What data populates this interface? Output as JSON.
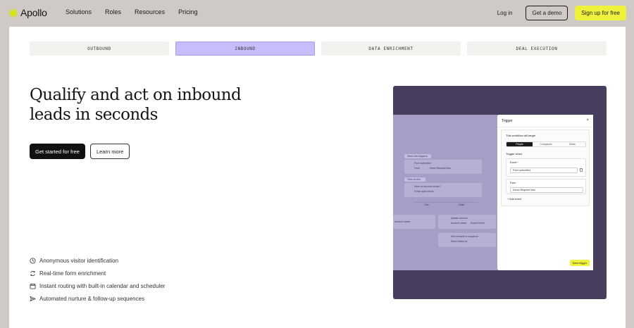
{
  "nav": {
    "brand": "Apollo",
    "links": [
      "Solutions",
      "Roles",
      "Resources",
      "Pricing"
    ],
    "login": "Log in",
    "demo": "Get a demo",
    "signup": "Sign up for free",
    "signup_color": "#eef23a"
  },
  "tabs": [
    {
      "label": "OUTBOUND",
      "active": false
    },
    {
      "label": "INBOUND",
      "active": true
    },
    {
      "label": "DATA ENRICHMENT",
      "active": false
    },
    {
      "label": "DEAL EXECUTION",
      "active": false
    }
  ],
  "hero": {
    "headline_line1": "Qualify and act on inbound",
    "headline_line2": "leads in seconds",
    "primary_cta": "Get started for free",
    "secondary_cta": "Learn more"
  },
  "features": [
    {
      "icon": "visitor-id-icon",
      "text": "Anonymous visitor identification"
    },
    {
      "icon": "refresh-icon",
      "text": "Real-time form enrichment"
    },
    {
      "icon": "calendar-icon",
      "text": "Instant routing with built-in calendar and scheduler"
    },
    {
      "icon": "send-icon",
      "text": "Automated nurture & follow-up sequences"
    }
  ],
  "product": {
    "canvas": {
      "when_label": "When this happens",
      "form_title": "Form submitted",
      "form_sub": "Form",
      "form_chip": "Demo Request Inbo",
      "then_label": "Then do this",
      "owner_title": "Have an account owner?",
      "owner_sub": "If then split criteria",
      "yes": "True",
      "no": "False",
      "account_owner": "Account owner",
      "update_title": "Update account",
      "update_chip1": "Account owner",
      "update_chip2": "Round Robin",
      "sequence_title": "Add contacts to sequence",
      "sequence_chip": "Demo follow up"
    },
    "trigger": {
      "title": "Trigger",
      "target_label": "This workflow will target",
      "segments": [
        "People",
        "Companies",
        "Deals"
      ],
      "active_segment": "People",
      "trigger_when": "Trigger when",
      "event_label": "Event *",
      "event_value": "Form submitted",
      "form_label": "Form",
      "form_value": "Demo Request Inbo",
      "add_event": "Add event",
      "save": "Save trigger"
    }
  }
}
